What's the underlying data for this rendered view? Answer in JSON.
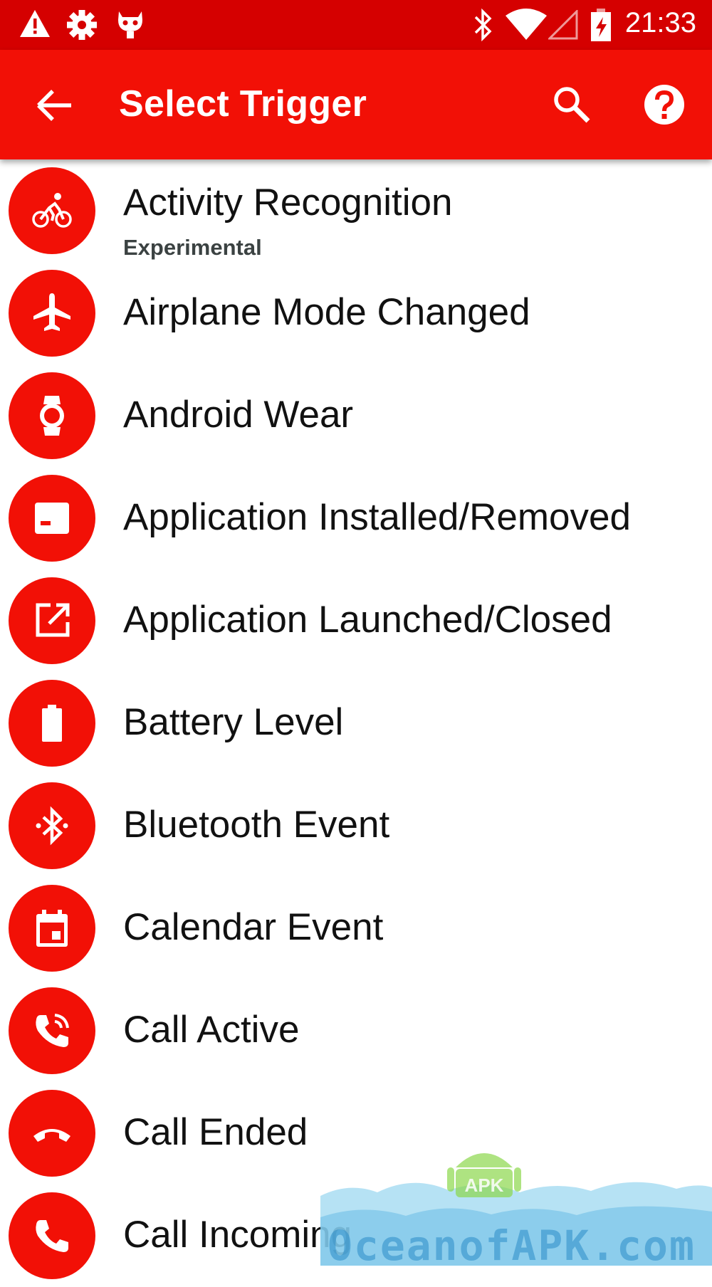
{
  "status_bar": {
    "time": "21:33",
    "icons": [
      "warning-icon",
      "settings-icon",
      "android-robot-icon",
      "bluetooth-icon",
      "wifi-icon",
      "no-signal-icon",
      "battery-charging-icon"
    ]
  },
  "app_bar": {
    "title": "Select Trigger",
    "icons": [
      "back-arrow-icon",
      "search-icon",
      "help-icon"
    ]
  },
  "triggers": [
    {
      "label": "Activity Recognition",
      "sublabel": "Experimental",
      "icon": "bike-icon"
    },
    {
      "label": "Airplane Mode Changed",
      "icon": "airplane-icon"
    },
    {
      "label": "Android Wear",
      "icon": "watch-icon"
    },
    {
      "label": "Application Installed/Removed",
      "icon": "app-box-icon"
    },
    {
      "label": "Application Launched/Closed",
      "icon": "launch-icon"
    },
    {
      "label": "Battery Level",
      "icon": "battery-icon"
    },
    {
      "label": "Bluetooth Event",
      "icon": "bluetooth-icon"
    },
    {
      "label": "Calendar Event",
      "icon": "calendar-icon"
    },
    {
      "label": "Call Active",
      "icon": "phone-in-talk-icon"
    },
    {
      "label": "Call Ended",
      "icon": "call-end-icon"
    },
    {
      "label": "Call Incoming",
      "icon": "phone-icon"
    }
  ],
  "watermark": {
    "text": "OceanofAPK.com",
    "badge": "APK"
  },
  "colors": {
    "status_bar": "#d50000",
    "app_bar": "#f21006",
    "icon_circle": "#f21006"
  }
}
